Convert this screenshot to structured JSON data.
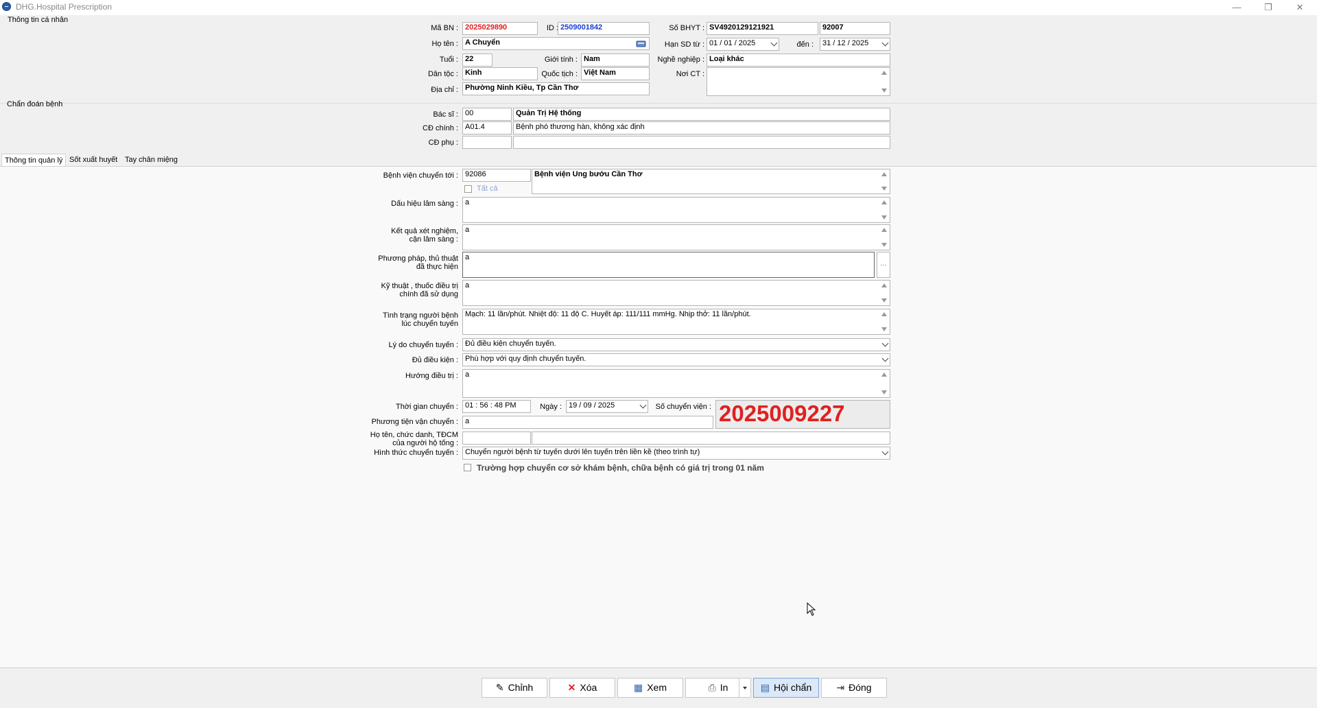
{
  "window": {
    "title": "DHG.Hospital Prescription",
    "minimize": "—",
    "maximize": "❐",
    "close": "✕"
  },
  "personal": {
    "group_label": "Thông tin cá nhân",
    "ma_bn_label": "Mã BN :",
    "ma_bn": "2025029890",
    "id_label": "ID :",
    "id": "2509001842",
    "ho_ten_label": "Họ tên :",
    "ho_ten": "A Chuyển",
    "tuoi_label": "Tuổi :",
    "tuoi": "22",
    "gioi_tinh_label": "Giới tính :",
    "gioi_tinh": "Nam",
    "dan_toc_label": "Dân tộc :",
    "dan_toc": "Kinh",
    "quoc_tich_label": "Quốc tịch :",
    "quoc_tich": "Việt Nam",
    "dia_chi_label": "Địa chỉ :",
    "dia_chi": "Phường Ninh Kiều, Tp Cần Thơ",
    "so_bhyt_label": "Số BHYT :",
    "so_bhyt": "SV4920129121921",
    "bhyt_code": "92007",
    "han_sd_label": "Hạn SD từ :",
    "han_sd_tu": "01 / 01 / 2025",
    "den_label": "đến :",
    "han_sd_den": "31 / 12 / 2025",
    "nghe_nghiep_label": "Nghề nghiệp :",
    "nghe_nghiep": "Loại khác",
    "noi_ct_label": "Nơi CT :",
    "noi_ct": ""
  },
  "diagnosis": {
    "group_label": "Chẩn đoán bệnh",
    "bac_si_label": "Bác sĩ :",
    "bac_si_code": "00",
    "bac_si_name": "Quản Trị Hệ thống",
    "cd_chinh_label": "CĐ chính :",
    "cd_chinh_code": "A01.4",
    "cd_chinh_text": "Bệnh phó thương hàn, không xác định",
    "cd_phu_label": "CĐ phụ :",
    "cd_phu_code": "",
    "cd_phu_text": ""
  },
  "tabs": [
    {
      "label": "Thông tin quản lý"
    },
    {
      "label": "Sốt xuất huyết"
    },
    {
      "label": "Tay chân miệng"
    }
  ],
  "transfer": {
    "bv_label": "Bệnh viện chuyển tới :",
    "bv_code": "92086",
    "bv_name": "Bệnh viện Ung bướu Cần Thơ",
    "tat_ca_label": "Tất cả",
    "dau_hieu_label": "Dấu hiệu lâm sàng :",
    "dau_hieu": "a",
    "ket_qua_label_1": "Kết quả xét nghiệm,",
    "ket_qua_label_2": "cận lâm sàng :",
    "ket_qua": "a",
    "phuong_phap_label_1": "Phương pháp, thủ thuật",
    "phuong_phap_label_2": "đã thực hiện",
    "phuong_phap": "a",
    "phuong_phap_more": "...",
    "ky_thuat_label_1": "Kỹ thuật , thuốc điều trị",
    "ky_thuat_label_2": "chính đã sử dụng",
    "ky_thuat": "a",
    "tinh_trang_label_1": "Tình trạng người bệnh",
    "tinh_trang_label_2": "lúc chuyển tuyến",
    "tinh_trang": "Mạch: 11 lần/phút. Nhiệt độ: 11 độ C. Huyết áp: 111/111 mmHg. Nhịp thở: 11 lần/phút.",
    "ly_do_label": "Lý do chuyển tuyến :",
    "ly_do": "Đủ điều kiện chuyển tuyến.",
    "du_dieu_kien_label": "Đủ điều kiện :",
    "du_dieu_kien": "Phù hợp với quy định chuyển tuyến.",
    "huong_dieu_tri_label": "Hướng điều trị :",
    "huong_dieu_tri": "a",
    "thoi_gian_label": "Thời gian chuyển :",
    "thoi_gian": "01 : 56 : 48   PM",
    "ngay_label": "Ngày :",
    "ngay": "19 / 09 / 2025",
    "so_chuyen_vien_label": "Số chuyển viện :",
    "so_chuyen_vien": "2025009227",
    "phuong_tien_label": "Phương tiện vận chuyển :",
    "phuong_tien": "a",
    "ho_ten_hotong_label_1": "Họ tên, chức danh, TĐCM",
    "ho_ten_hotong_label_2": "của người hộ tống :",
    "ho_ten_hotong_code": "",
    "ho_ten_hotong_name": "",
    "hinh_thuc_label": "Hình thức chuyển tuyến :",
    "hinh_thuc": "Chuyển người bệnh từ tuyến dưới lên tuyến trên liền kề (theo trình tự)",
    "truong_hop_label": "Trường hợp chuyển cơ sở khám bệnh, chữa bệnh có giá trị trong 01 năm"
  },
  "buttons": {
    "chinh": "Chỉnh",
    "xoa": "Xóa",
    "xem": "Xem",
    "in": "In",
    "hoi_chan": "Hội chẩn",
    "dong": "Đóng"
  }
}
